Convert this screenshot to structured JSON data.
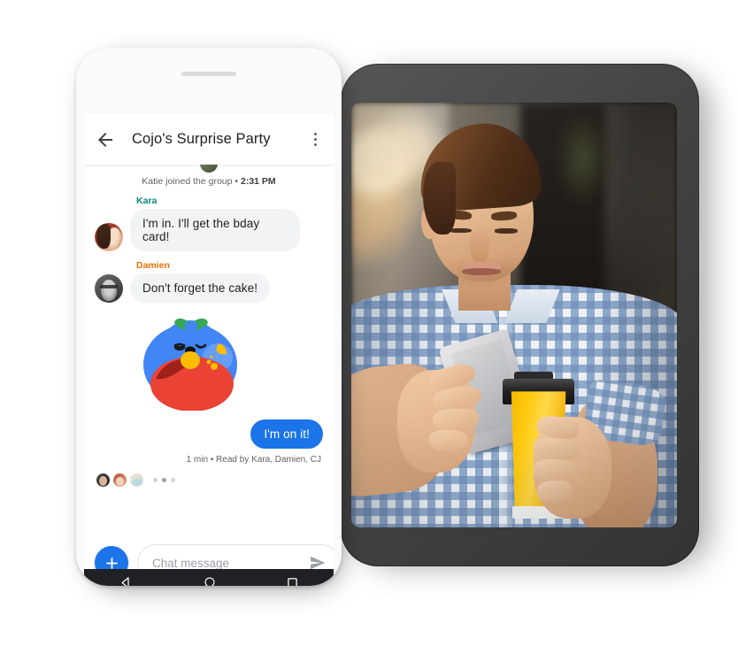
{
  "scene": {
    "description": "Messaging app on a white smartphone overlapping a dark gray tablet showing a photo of a man with a coffee cup using a phone"
  },
  "phone": {
    "appbar": {
      "back_icon": "arrow-left-icon",
      "title": "Cojo's Surprise Party",
      "overflow_icon": "more-vert-icon"
    },
    "thread": {
      "system_event": {
        "text": "Katie joined the group",
        "separator": "•",
        "time": "2:31 PM",
        "avatar": "katie-avatar"
      },
      "messages": [
        {
          "sender": "Kara",
          "sender_color": "#0b8a7a",
          "text": "I'm in. I'll get the bday card!",
          "avatar": "kara-avatar",
          "type": "text",
          "side": "incoming"
        },
        {
          "sender": "Damien",
          "sender_color": "#e8710a",
          "text": "Don't forget the cake!",
          "avatar": "damien-avatar",
          "type": "text",
          "side": "incoming"
        },
        {
          "sender": "",
          "type": "sticker",
          "sticker_name": "blue-blob-eating-apple-sticker",
          "side": "incoming"
        },
        {
          "sender": "",
          "text": "I'm on it!",
          "type": "text",
          "side": "outgoing"
        }
      ],
      "receipt": "1 min • Read by Kara, Damien, CJ",
      "readers": [
        "reader-avatar-1",
        "reader-avatar-2",
        "reader-avatar-3"
      ],
      "page_dots": 3,
      "page_dot_active": 2
    },
    "composer": {
      "add_label": "+",
      "add_icon": "plus-icon",
      "placeholder": "Chat message",
      "value": "",
      "send_icon": "send-icon"
    },
    "navbar": {
      "back_icon": "nav-back-triangle-icon",
      "home_icon": "nav-home-circle-icon",
      "recents_icon": "nav-recents-square-icon"
    }
  },
  "tablet": {
    "photo_alt": "man-with-coffee-and-phone-photo"
  },
  "colors": {
    "accent_blue": "#1b74e8",
    "bubble_gray": "#f1f3f4",
    "text_primary": "#202124",
    "text_secondary": "#5f6368",
    "kara_green": "#0b8a7a",
    "damien_orange": "#e8710a",
    "navbar_dark": "#202124",
    "tablet_bezel": "#474747"
  }
}
